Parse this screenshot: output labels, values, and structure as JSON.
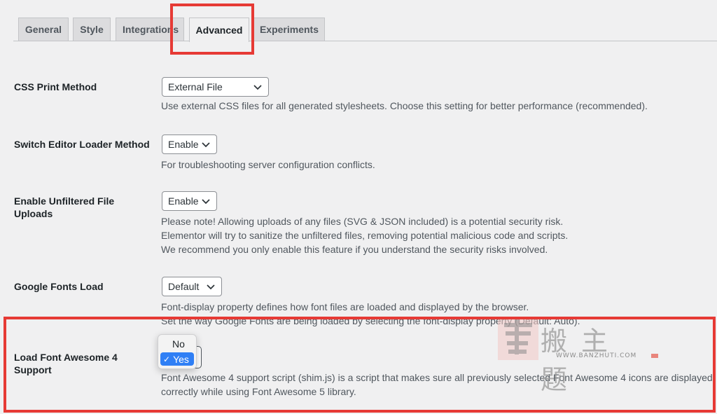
{
  "tabs": [
    {
      "label": "General"
    },
    {
      "label": "Style"
    },
    {
      "label": "Integrations"
    },
    {
      "label": "Advanced",
      "active": true
    },
    {
      "label": "Experiments"
    }
  ],
  "settings": {
    "css_print": {
      "label": "CSS Print Method",
      "value": "External File",
      "description": "Use external CSS files for all generated stylesheets. Choose this setting for better performance (recommended)."
    },
    "editor_loader": {
      "label": "Switch Editor Loader Method",
      "value": "Enable",
      "description": "For troubleshooting server configuration conflicts."
    },
    "unfiltered_uploads": {
      "label_line1": "Enable Unfiltered File",
      "label_line2": "Uploads",
      "value": "Enable",
      "description_lines": [
        "Please note! Allowing uploads of any files (SVG & JSON included) is a potential security risk.",
        "Elementor will try to sanitize the unfiltered files, removing potential malicious code and scripts.",
        "We recommend you only enable this feature if you understand the security risks involved."
      ]
    },
    "google_fonts": {
      "label": "Google Fonts Load",
      "value": "Default",
      "description_lines": [
        "Font-display property defines how font files are loaded and displayed by the browser.",
        "Set the way Google Fonts are being loaded by selecting the font-display property (Default: Auto)."
      ]
    },
    "font_awesome": {
      "label_line1": "Load Font Awesome 4",
      "label_line2": "Support",
      "options": [
        "No",
        "Yes"
      ],
      "selected_check": "✓",
      "selected": "Yes",
      "description_lines": [
        "Font Awesome 4 support script (shim.js) is a script that makes sure all previously selected Font Awesome 4 icons are displayed",
        "correctly while using Font Awesome 5 library."
      ]
    }
  },
  "watermark": {
    "main": "搬主题",
    "sub": "WWW.BANZHUTI.COM"
  },
  "colors": {
    "highlight": "#e63a35",
    "selected_option": "#2f7ff5"
  }
}
